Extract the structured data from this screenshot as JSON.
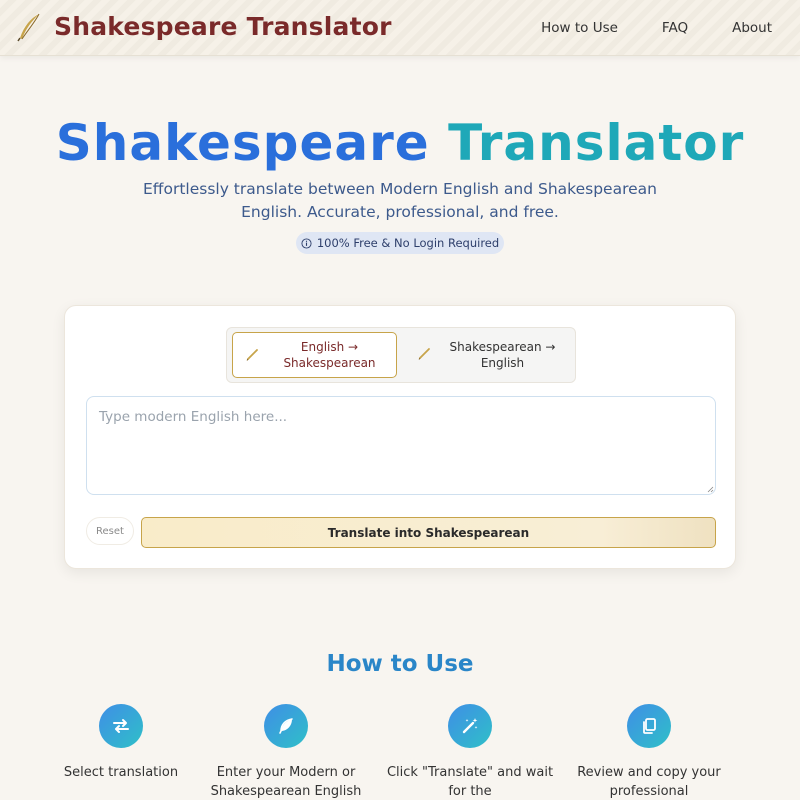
{
  "header": {
    "brand_title": "Shakespeare Translator",
    "nav": [
      "How to Use",
      "FAQ",
      "About"
    ]
  },
  "hero": {
    "title_part1": "Shakespeare",
    "title_part2": "Translator",
    "subtitle": "Effortlessly translate between Modern English and Shakespearean English. Accurate, professional, and free.",
    "badge": "100% Free & No Login Required"
  },
  "translator": {
    "modes": [
      {
        "label": "English → Shakespearean",
        "active": true
      },
      {
        "label": "Shakespearean → English",
        "active": false
      }
    ],
    "input_placeholder": "Type modern English here...",
    "input_value": "",
    "reset_label": "Reset",
    "translate_label": "Translate into Shakespearean"
  },
  "how_to_use": {
    "title": "How to Use",
    "steps": [
      {
        "icon": "swap-arrows-icon",
        "text": "Select translation"
      },
      {
        "icon": "feather-icon",
        "text": "Enter your Modern or Shakespearean English"
      },
      {
        "icon": "magic-wand-icon",
        "text": "Click \"Translate\" and wait for the"
      },
      {
        "icon": "copy-icon",
        "text": "Review and copy your professional"
      }
    ]
  },
  "colors": {
    "brand": "#7a2a2a",
    "accent_blue": "#2a6fdb",
    "accent_teal": "#1fa8b8",
    "gold": "#c7a44a",
    "background": "#f8f5f0"
  }
}
